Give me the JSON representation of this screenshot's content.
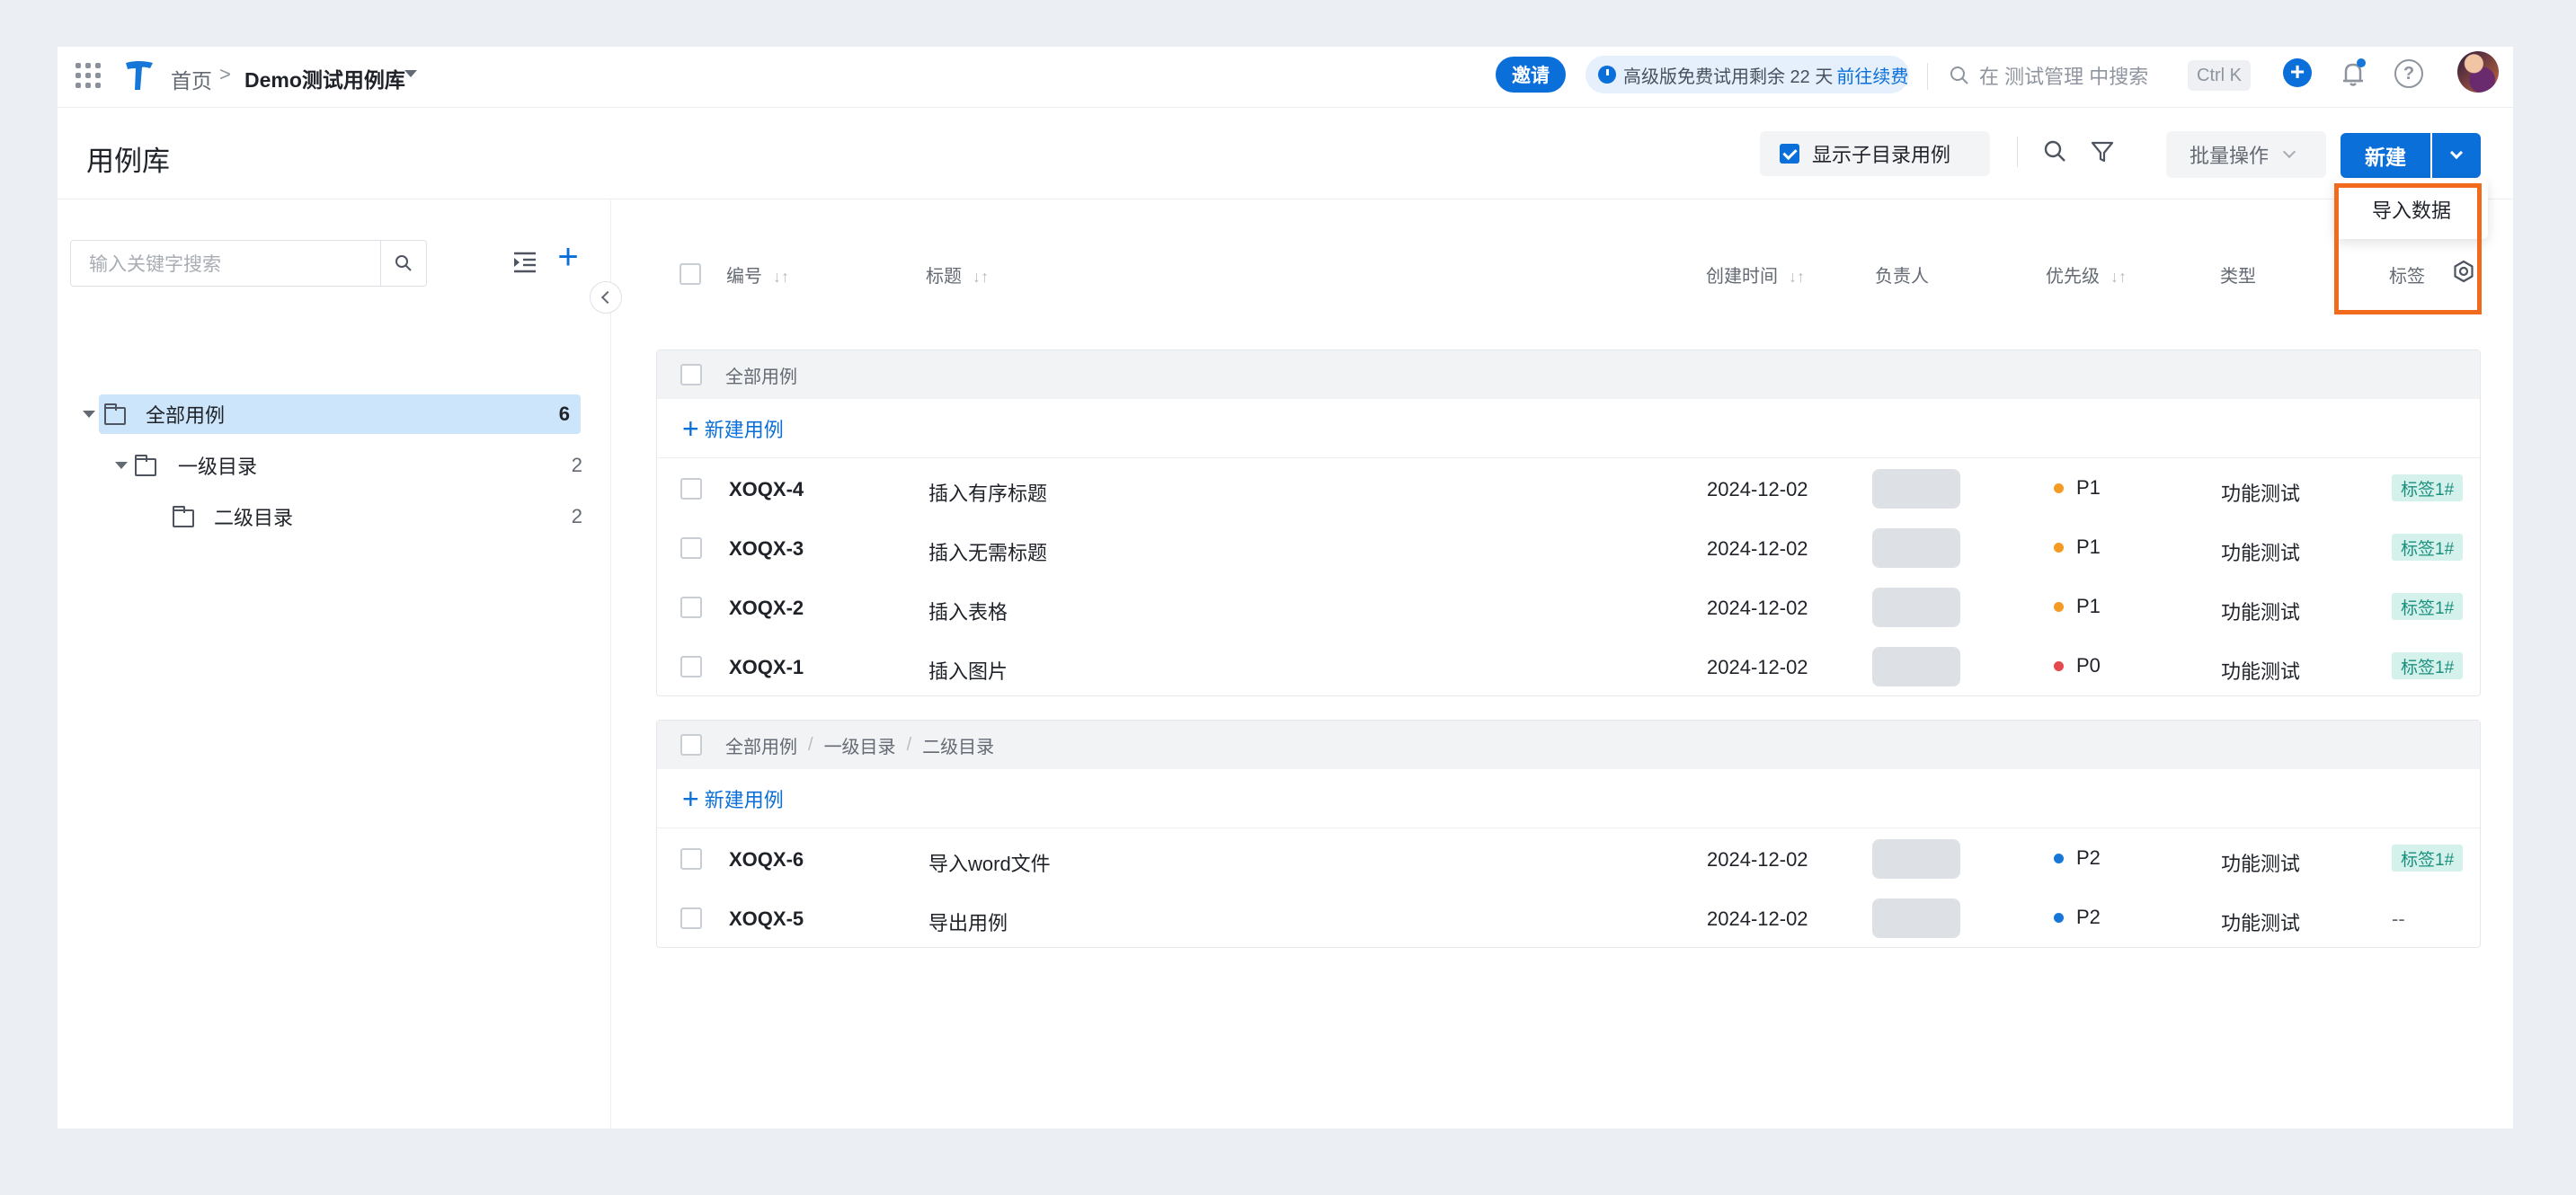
{
  "topbar": {
    "home": "首页",
    "library": "Demo测试用例库",
    "invite": "邀请",
    "trial_text": "高级版免费试用剩余 22 天",
    "trial_link": "前往续费",
    "search_placeholder": "在 测试管理 中搜索",
    "shortcut": "Ctrl K"
  },
  "header": {
    "title": "用例库",
    "show_sub": "显示子目录用例",
    "batch": "批量操作",
    "new": "新建",
    "dropdown_item": "导入数据"
  },
  "sidebar": {
    "search_placeholder": "输入关键字搜索",
    "tree": [
      {
        "label": "全部用例",
        "count": "6"
      },
      {
        "label": "一级目录",
        "count": "2"
      },
      {
        "label": "二级目录",
        "count": "2"
      }
    ]
  },
  "table": {
    "columns": {
      "id": "编号",
      "title": "标题",
      "created": "创建时间",
      "owner": "负责人",
      "priority": "优先级",
      "type": "类型",
      "tag": "标签"
    },
    "new_case": "新建用例",
    "group1": {
      "path": [
        "全部用例"
      ],
      "rows": [
        {
          "id": "XOQX-4",
          "title": "插入有序标题",
          "date": "2024-12-02",
          "priority": "P1",
          "prio_color": "#f59a23",
          "type": "功能测试",
          "tag": "标签1#"
        },
        {
          "id": "XOQX-3",
          "title": "插入无需标题",
          "date": "2024-12-02",
          "priority": "P1",
          "prio_color": "#f59a23",
          "type": "功能测试",
          "tag": "标签1#"
        },
        {
          "id": "XOQX-2",
          "title": "插入表格",
          "date": "2024-12-02",
          "priority": "P1",
          "prio_color": "#f59a23",
          "type": "功能测试",
          "tag": "标签1#"
        },
        {
          "id": "XOQX-1",
          "title": "插入图片",
          "date": "2024-12-02",
          "priority": "P0",
          "prio_color": "#e5484d",
          "type": "功能测试",
          "tag": "标签1#"
        }
      ]
    },
    "group2": {
      "path": [
        "全部用例",
        "一级目录",
        "二级目录"
      ],
      "path_sep": "/",
      "rows": [
        {
          "id": "XOQX-6",
          "title": "导入word文件",
          "date": "2024-12-02",
          "priority": "P2",
          "prio_color": "#1677d8",
          "type": "功能测试",
          "tag": "标签1#"
        },
        {
          "id": "XOQX-5",
          "title": "导出用例",
          "date": "2024-12-02",
          "priority": "P2",
          "prio_color": "#1677d8",
          "type": "功能测试",
          "tag": "--"
        }
      ]
    }
  }
}
